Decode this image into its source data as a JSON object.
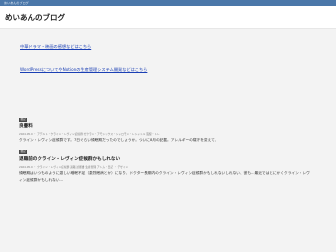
{
  "topbar": {
    "tagline": "めいあんのブログ"
  },
  "header": {
    "site_title": "めいあんのブログ"
  },
  "links": [
    {
      "label": "中華ドラマ・映画の感想などはこちら"
    },
    {
      "label": "WordPressについてやNotionの生産管理システム開発などはこちら"
    }
  ],
  "posts": [
    {
      "tag": "雑記",
      "title": "良書料",
      "meta": "2024.05.0 ・ アデルト・クライン・レヴィン症候群 ゼクラン・アモシックス・シャロモン・レシャトル 遺留・トレ",
      "excerpt": [
        "クライン・レヴィン症候群です。7日ぐらい傾眠期だったのでしょうか。ついに8月の記載。アレルギーの寝汗を変えて、"
      ]
    },
    {
      "tag": "雑記",
      "title": "退職前のクライン・レヴィン症候群かもしれない",
      "meta": "2024.05.0 ・ クライン・レヴィン症候群 退職 診断書 生産管理 アトム・日記 ・ デザイン",
      "excerpt": [
        "傾眠期はいつものように激しい睡眠不足（激烈眠病とか）になり、ドクター長期内のクライン・レヴィン症候群かもしれないしれない、彼も...最近ではとにかくクライン・レヴ",
        "ィン症候群かもしれない..."
      ]
    }
  ]
}
